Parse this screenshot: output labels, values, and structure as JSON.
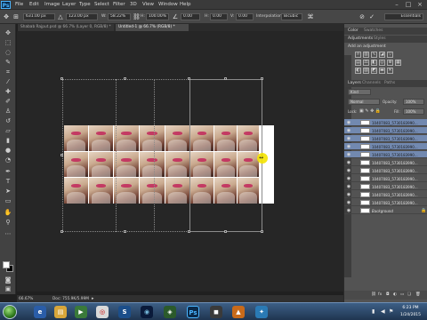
{
  "app": {
    "logo": "Ps"
  },
  "menubar": {
    "items": [
      "File",
      "Edit",
      "Image",
      "Layer",
      "Type",
      "Select",
      "Filter",
      "3D",
      "View",
      "Window",
      "Help"
    ]
  },
  "options": {
    "x_value": "631.00 px",
    "y_value": "123.00 px",
    "w_label": "W:",
    "w_value": "58.22%",
    "h_label": "H:",
    "h_value": "100.00%",
    "angle_value": "0.00",
    "h_skew_label": "H:",
    "h_skew_value": "0.00",
    "v_skew_label": "V:",
    "v_skew_value": "0.00",
    "interp_label": "Interpolation:",
    "interp_value": "Bicubic",
    "workspace": "Essentials"
  },
  "doc_tabs": [
    {
      "label": "Shabab Rajput.psd @ 66.7% (Layer 0, RGB/8) *",
      "active": false
    },
    {
      "label": "Untitled-1 @ 66.7% (RGB/8) *",
      "active": true
    }
  ],
  "status": {
    "zoom": "66.67%",
    "doc_info": "Doc: 755.9K/5.99M"
  },
  "panels": {
    "top_tabs": [
      "Color",
      "Swatches"
    ],
    "adj_tabs": [
      "Adjustments",
      "Styles"
    ],
    "adj_title": "Add an adjustment",
    "layers_tabs": [
      "Layers",
      "Channels",
      "Paths"
    ],
    "kind_label": "Kind",
    "blend_mode": "Normal",
    "opacity_label": "Opacity:",
    "opacity_value": "100%",
    "lock_label": "Lock:",
    "fill_label": "Fill:",
    "fill_value": "100%",
    "layers": [
      {
        "name": "10407083_5730183990...",
        "selected": true
      },
      {
        "name": "10407083_5730183990...",
        "selected": true
      },
      {
        "name": "10407083_5730183990...",
        "selected": true
      },
      {
        "name": "10407083_5730183990...",
        "selected": true
      },
      {
        "name": "10407083_5730183990...",
        "selected": true
      },
      {
        "name": "10407083_5730183990...",
        "selected": false
      },
      {
        "name": "10407083_5730183990...",
        "selected": false
      },
      {
        "name": "10407083_5730183990...",
        "selected": false
      },
      {
        "name": "10407083_5730183990...",
        "selected": false
      },
      {
        "name": "10407083_5730183990...",
        "selected": false
      },
      {
        "name": "10407083_5730183990...",
        "selected": false
      },
      {
        "name": "Background",
        "selected": false
      }
    ]
  },
  "taskbar": {
    "time": "6:23 PM",
    "date": "1/24/2015"
  }
}
